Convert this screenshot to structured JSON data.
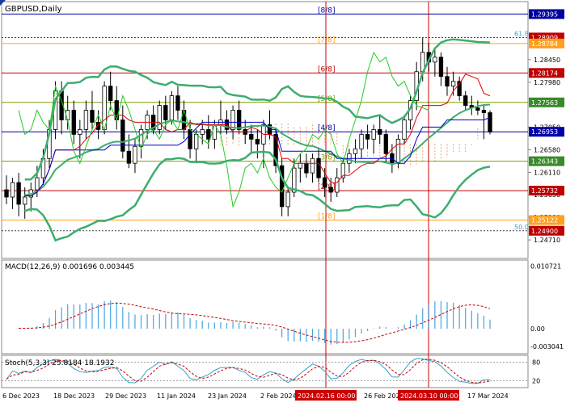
{
  "window": {
    "title": "GBPUSD,Daily"
  },
  "colors": {
    "background": "#ffffff",
    "grid": "#c8c8c8",
    "bull_candle": "#ffffff",
    "bear_candle": "#000000",
    "bollinger": "#3cae6e",
    "ma_red": "#e00000",
    "ma_blue": "#0000cc",
    "ma_green": "#22cc22",
    "ichimoku_cloud": "#f0a070",
    "murray_red": "#c00000",
    "murray_orange": "#ffa020",
    "murray_green": "#80a000",
    "murray_blue": "#0000a0",
    "current_price": "#0000aa",
    "macd_hist": "#4aa3df",
    "macd_signal": "#cc0000",
    "stoch_main": "#3aa0c8",
    "stoch_signal": "#cc0000"
  },
  "time_axis": {
    "labels": [
      "6 Dec 2023",
      "18 Dec 2023",
      "29 Dec 2023",
      "11 Jan 2024",
      "23 Jan 2024",
      "2 Feb 2024",
      "26 Feb 2024",
      "17 Mar 2024"
    ],
    "highlights": [
      "2024.02.16 00:00",
      "2024.03.10 00:00"
    ]
  },
  "chart_data": [
    {
      "type": "candlestick",
      "title": "GBPUSD,Daily",
      "ylim": [
        1.2436,
        1.2962
      ],
      "price_labels": [
        "1.28450",
        "1.27980",
        "1.27050",
        "1.26580",
        "1.26110",
        "1.25650",
        "1.25180",
        "1.24710"
      ],
      "price_tags": [
        {
          "label": "1.29395",
          "value": 1.29395,
          "color": "#0000a0"
        },
        {
          "label": "1.28909",
          "value": 1.28909,
          "color": "#c00000"
        },
        {
          "label": "1.28784",
          "value": 1.28784,
          "color": "#ffa020"
        },
        {
          "label": "1.28174",
          "value": 1.28174,
          "color": "#c00000"
        },
        {
          "label": "1.27563",
          "value": 1.27563,
          "color": "#3a8a2a"
        },
        {
          "label": "1.26953",
          "value": 1.26953,
          "color": "#0000aa"
        },
        {
          "label": "1.26343",
          "value": 1.26343,
          "color": "#3a8a2a"
        },
        {
          "label": "1.25732",
          "value": 1.25732,
          "color": "#c00000"
        },
        {
          "label": "1.25122",
          "value": 1.25122,
          "color": "#ffa020"
        },
        {
          "label": "1.24900",
          "value": 1.249,
          "color": "#c00000"
        }
      ],
      "murray_levels": [
        {
          "label": "[8/8]",
          "value": 1.29395,
          "color": "#0000a0"
        },
        {
          "label": "[7/8]",
          "value": 1.28784,
          "color": "#ffa020"
        },
        {
          "label": "[6/8]",
          "value": 1.28174,
          "color": "#c00000"
        },
        {
          "label": "[5/8]",
          "value": 1.27563,
          "color": "#80a000"
        },
        {
          "label": "[4/8]",
          "value": 1.26953,
          "color": "#0000a0"
        },
        {
          "label": "[3/8]",
          "value": 1.26343,
          "color": "#80a000"
        },
        {
          "label": "[2/8]",
          "value": 1.25732,
          "color": "#c00000"
        },
        {
          "label": "[1/8]",
          "value": 1.25122,
          "color": "#ffa020"
        }
      ],
      "fibo_levels": [
        {
          "label": "61.8",
          "value": 1.28909
        },
        {
          "label": "50.0",
          "value": 1.249
        }
      ],
      "candles": [
        [
          1.2575,
          1.2605,
          1.2545,
          1.256
        ],
        [
          1.256,
          1.26,
          1.2535,
          1.259
        ],
        [
          1.259,
          1.261,
          1.252,
          1.2545
        ],
        [
          1.2545,
          1.258,
          1.2515,
          1.256
        ],
        [
          1.256,
          1.259,
          1.253,
          1.2575
        ],
        [
          1.2575,
          1.2625,
          1.256,
          1.26
        ],
        [
          1.26,
          1.266,
          1.2585,
          1.264
        ],
        [
          1.264,
          1.272,
          1.262,
          1.27
        ],
        [
          1.27,
          1.28,
          1.268,
          1.278
        ],
        [
          1.278,
          1.28,
          1.269,
          1.272
        ],
        [
          1.272,
          1.277,
          1.27,
          1.274
        ],
        [
          1.274,
          1.276,
          1.267,
          1.269
        ],
        [
          1.269,
          1.272,
          1.264,
          1.27
        ],
        [
          1.27,
          1.276,
          1.268,
          1.274
        ],
        [
          1.274,
          1.278,
          1.27,
          1.2715
        ],
        [
          1.2715,
          1.274,
          1.268,
          1.27
        ],
        [
          1.27,
          1.28,
          1.269,
          1.279
        ],
        [
          1.279,
          1.282,
          1.274,
          1.276
        ],
        [
          1.276,
          1.279,
          1.27,
          1.272
        ],
        [
          1.272,
          1.275,
          1.264,
          1.2655
        ],
        [
          1.2655,
          1.269,
          1.262,
          1.263
        ],
        [
          1.263,
          1.268,
          1.261,
          1.2665
        ],
        [
          1.2665,
          1.271,
          1.264,
          1.27
        ],
        [
          1.27,
          1.274,
          1.268,
          1.273
        ],
        [
          1.273,
          1.275,
          1.269,
          1.27
        ],
        [
          1.27,
          1.276,
          1.269,
          1.275
        ],
        [
          1.275,
          1.277,
          1.27,
          1.272
        ],
        [
          1.272,
          1.278,
          1.271,
          1.277
        ],
        [
          1.277,
          1.279,
          1.272,
          1.274
        ],
        [
          1.274,
          1.276,
          1.268,
          1.27
        ],
        [
          1.27,
          1.272,
          1.264,
          1.266
        ],
        [
          1.266,
          1.27,
          1.263,
          1.269
        ],
        [
          1.269,
          1.272,
          1.267,
          1.27
        ],
        [
          1.27,
          1.273,
          1.266,
          1.268
        ],
        [
          1.268,
          1.272,
          1.266,
          1.271
        ],
        [
          1.271,
          1.276,
          1.269,
          1.272
        ],
        [
          1.272,
          1.274,
          1.269,
          1.27
        ],
        [
          1.27,
          1.275,
          1.268,
          1.274
        ],
        [
          1.274,
          1.276,
          1.269,
          1.27
        ],
        [
          1.27,
          1.272,
          1.267,
          1.269
        ],
        [
          1.269,
          1.271,
          1.265,
          1.268
        ],
        [
          1.268,
          1.27,
          1.264,
          1.267
        ],
        [
          1.267,
          1.272,
          1.262,
          1.271
        ],
        [
          1.271,
          1.274,
          1.268,
          1.269
        ],
        [
          1.269,
          1.27,
          1.261,
          1.2625
        ],
        [
          1.2625,
          1.264,
          1.252,
          1.254
        ],
        [
          1.254,
          1.258,
          1.252,
          1.257
        ],
        [
          1.257,
          1.264,
          1.256,
          1.262
        ],
        [
          1.262,
          1.265,
          1.259,
          1.263
        ],
        [
          1.263,
          1.265,
          1.26,
          1.261
        ],
        [
          1.261,
          1.265,
          1.259,
          1.264
        ],
        [
          1.264,
          1.266,
          1.259,
          1.26
        ],
        [
          1.26,
          1.262,
          1.256,
          1.258
        ],
        [
          1.258,
          1.26,
          1.255,
          1.257
        ],
        [
          1.257,
          1.262,
          1.256,
          1.26
        ],
        [
          1.26,
          1.264,
          1.259,
          1.263
        ],
        [
          1.263,
          1.266,
          1.261,
          1.265
        ],
        [
          1.265,
          1.268,
          1.263,
          1.266
        ],
        [
          1.266,
          1.27,
          1.264,
          1.269
        ],
        [
          1.269,
          1.271,
          1.266,
          1.268
        ],
        [
          1.268,
          1.271,
          1.265,
          1.27
        ],
        [
          1.27,
          1.273,
          1.267,
          1.269
        ],
        [
          1.269,
          1.27,
          1.263,
          1.265
        ],
        [
          1.265,
          1.267,
          1.261,
          1.263
        ],
        [
          1.263,
          1.269,
          1.262,
          1.268
        ],
        [
          1.268,
          1.273,
          1.267,
          1.272
        ],
        [
          1.272,
          1.277,
          1.27,
          1.276
        ],
        [
          1.276,
          1.284,
          1.274,
          1.282
        ],
        [
          1.282,
          1.289,
          1.28,
          1.286
        ],
        [
          1.286,
          1.288,
          1.282,
          1.284
        ],
        [
          1.284,
          1.287,
          1.281,
          1.285
        ],
        [
          1.285,
          1.286,
          1.279,
          1.281
        ],
        [
          1.281,
          1.283,
          1.277,
          1.279
        ],
        [
          1.279,
          1.282,
          1.277,
          1.28
        ],
        [
          1.28,
          1.281,
          1.276,
          1.277
        ],
        [
          1.277,
          1.278,
          1.274,
          1.275
        ],
        [
          1.275,
          1.277,
          1.273,
          1.2745
        ],
        [
          1.2745,
          1.276,
          1.273,
          1.274
        ],
        [
          1.274,
          1.275,
          1.268,
          1.2735
        ],
        [
          1.2735,
          1.274,
          1.269,
          1.2695
        ]
      ]
    },
    {
      "type": "bar",
      "title": "MACD(12,26,9) 0.001696 0.003445",
      "price_labels": [
        "0.010721",
        "0.00",
        "-0.003041"
      ],
      "ylim": [
        -0.004,
        0.0115
      ]
    },
    {
      "type": "line",
      "title": "Stoch(5,3,3) 25.8184 18.1932",
      "price_labels": [
        "80",
        "20"
      ],
      "ylim": [
        0,
        100
      ]
    }
  ]
}
